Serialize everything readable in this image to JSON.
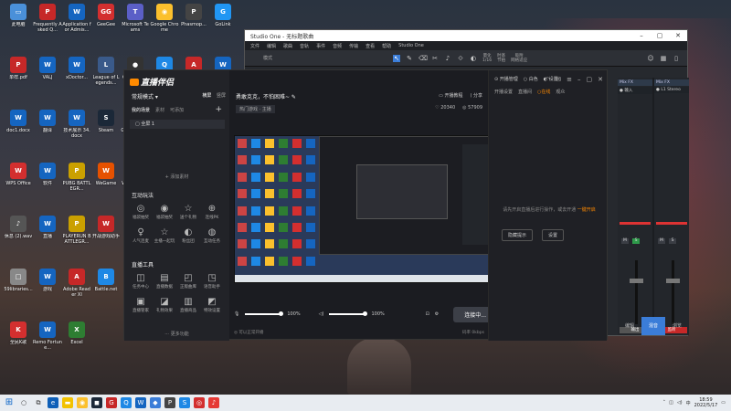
{
  "desktop": {
    "icons": [
      {
        "label": "此电脑",
        "color": "#4a90d9",
        "glyph": "▭"
      },
      {
        "label": "Frequently Asked Q...",
        "color": "#c62828",
        "glyph": "P"
      },
      {
        "label": "Application for Admis...",
        "color": "#1565c0",
        "glyph": "W"
      },
      {
        "label": "GeeGee",
        "color": "#d32f2f",
        "glyph": "GG"
      },
      {
        "label": "Microsoft Teams",
        "color": "#5b5fc7",
        "glyph": "T"
      },
      {
        "label": "Google Chrome",
        "color": "#fbc02d",
        "glyph": "◉"
      },
      {
        "label": "Phasmop...",
        "color": "#444",
        "glyph": "P"
      },
      {
        "label": "GoLink",
        "color": "#2196f3",
        "glyph": "G"
      },
      {
        "label": "单样.pdf",
        "color": "#c62828",
        "glyph": "P"
      },
      {
        "label": "VALJ",
        "color": "#1565c0",
        "glyph": "W"
      },
      {
        "label": "xDoctor...",
        "color": "#1565c0",
        "glyph": "W"
      },
      {
        "label": "League of Legends...",
        "color": "#3a5a8a",
        "glyph": "L"
      },
      {
        "label": "OBS Studio",
        "color": "#333",
        "glyph": "●"
      },
      {
        "label": "腾讯QQ",
        "color": "#1e88e5",
        "glyph": "Q"
      },
      {
        "label": "AMAE",
        "color": "#c62828",
        "glyph": "A"
      },
      {
        "label": "Manuscript...",
        "color": "#1565c0",
        "glyph": "W"
      },
      {
        "label": "doc1.docx",
        "color": "#1565c0",
        "glyph": "W"
      },
      {
        "label": "翻译",
        "color": "#1565c0",
        "glyph": "W"
      },
      {
        "label": "技术展示 34.docx",
        "color": "#1565c0",
        "glyph": "W"
      },
      {
        "label": "Steam",
        "color": "#1b2838",
        "glyph": "S"
      },
      {
        "label": "GeForce Experience",
        "color": "#76b900",
        "glyph": "G"
      },
      {
        "label": "论文",
        "color": "#1565c0",
        "glyph": "W"
      },
      {
        "label": "download",
        "color": "#2196f3",
        "glyph": "e"
      },
      {
        "label": "ToDesk",
        "color": "#1e88e5",
        "glyph": "T"
      },
      {
        "label": "WPS Office",
        "color": "#d32f2f",
        "glyph": "W"
      },
      {
        "label": "软件",
        "color": "#1565c0",
        "glyph": "W"
      },
      {
        "label": "PUBG BATTLEGR...",
        "color": "#caa000",
        "glyph": "P"
      },
      {
        "label": "WeGame",
        "color": "#e65100",
        "glyph": "W"
      },
      {
        "label": "Wallpaper Engine...",
        "color": "#1565c0",
        "glyph": "W"
      },
      {
        "label": "美计...",
        "color": "#1565c0",
        "glyph": "W"
      },
      {
        "label": "使用说明 202...",
        "color": "#1565c0",
        "glyph": "W"
      },
      {
        "label": "风暴英雄",
        "color": "#1565c0",
        "glyph": "W"
      },
      {
        "label": "休息 (2).wav",
        "color": "#555",
        "glyph": "♪"
      },
      {
        "label": "直播",
        "color": "#1565c0",
        "glyph": "W"
      },
      {
        "label": "PLAYERUN BATTLEGR...",
        "color": "#caa000",
        "glyph": "P"
      },
      {
        "label": "开战游戏助手",
        "color": "#c62828",
        "glyph": "W"
      },
      {
        "label": "网易",
        "color": "#1565c0",
        "glyph": "W"
      },
      {
        "label": "登记",
        "color": "#1565c0",
        "glyph": "W"
      },
      {
        "label": "SE对战平台",
        "color": "#1565c0",
        "glyph": "S"
      },
      {
        "label": "网易云",
        "color": "#d32f2f",
        "glyph": "▶"
      },
      {
        "label": "59libraries...",
        "color": "#888",
        "glyph": "□"
      },
      {
        "label": "游戏",
        "color": "#1565c0",
        "glyph": "W"
      },
      {
        "label": "Adobe Reader XI",
        "color": "#c62828",
        "glyph": "A"
      },
      {
        "label": "Battle.net",
        "color": "#1e88e5",
        "glyph": "B"
      },
      {
        "label": "VAL",
        "color": "#1565c0",
        "glyph": "W"
      },
      {
        "label": "直播工具",
        "color": "#1565c0",
        "glyph": "W"
      },
      {
        "label": "AMD虚拟主播 系统",
        "color": "#444",
        "glyph": "A"
      },
      {
        "label": "网易UU加速器",
        "color": "#d32f2f",
        "glyph": "U"
      },
      {
        "label": "全民K歌",
        "color": "#d32f2f",
        "glyph": "K"
      },
      {
        "label": "Remo Fortune...",
        "color": "#1565c0",
        "glyph": "W"
      },
      {
        "label": "Excel",
        "color": "#2e7d32",
        "glyph": "X"
      }
    ]
  },
  "studio_one": {
    "title": "Studio One - 无标题歌曲",
    "menu": [
      "文件",
      "编辑",
      "歌曲",
      "音轨",
      "事件",
      "音频",
      "传输",
      "查看",
      "帮助",
      "Studio One"
    ],
    "toolbar": {
      "mode": "模式",
      "quantize_label": "量化",
      "quantize_value": "1/16",
      "timebase_label": "时基",
      "timebase_value": "节拍",
      "snap_label": "吸附",
      "snap_value": "网格适应"
    },
    "mixer_channels": [
      {
        "name": "Mix FX",
        "input": "● 输入",
        "out": "输出",
        "out_color": "#555",
        "mute": "M",
        "solo": "S"
      },
      {
        "name": "Mix FX",
        "input": "● L1 Stereo",
        "out": "监听",
        "out_color": "#c62828",
        "mute": "M",
        "solo": "S"
      }
    ],
    "bottom_tabs": [
      {
        "label": "编辑",
        "selected": false
      },
      {
        "label": "混音",
        "selected": true
      },
      {
        "label": "浏览",
        "selected": false
      }
    ]
  },
  "live_app": {
    "logo": "直播伴侣",
    "mode": "常规模式 ▾",
    "mode_buttons": [
      "横屏",
      "竖屏"
    ],
    "scene_tabs": [
      "我的场景",
      "素材",
      "可添加"
    ],
    "scene_item": "▢ 全屏 1",
    "add_source": "+ 添加素材",
    "interact_title": "互动玩法",
    "interact_items": [
      {
        "glyph": "◎",
        "label": "福袋抽奖"
      },
      {
        "glyph": "◉",
        "label": "福袋抽奖"
      },
      {
        "glyph": "☆",
        "label": "送个礼物"
      },
      {
        "glyph": "⊕",
        "label": "连线PK"
      },
      {
        "glyph": "♀",
        "label": "人气连麦"
      },
      {
        "glyph": "☆",
        "label": "主播一起玩"
      },
      {
        "glyph": "◐",
        "label": "粉丝团"
      },
      {
        "glyph": "◍",
        "label": "互动任务"
      }
    ],
    "tools_title": "直播工具",
    "tool_items": [
      {
        "glyph": "◫",
        "label": "任务中心"
      },
      {
        "glyph": "▤",
        "label": "直播数据"
      },
      {
        "glyph": "◰",
        "label": "正版曲库"
      },
      {
        "glyph": "◳",
        "label": "语音助手"
      },
      {
        "glyph": "▣",
        "label": "直播管家"
      },
      {
        "glyph": "◪",
        "label": "礼物效果"
      },
      {
        "glyph": "▥",
        "label": "直播商品"
      },
      {
        "glyph": "◩",
        "label": "特效设置"
      }
    ],
    "more": "⋯ 更多功能",
    "room_title": "勇敢克克，不怕困难~ ✎",
    "room_tag": "热门游戏 · 主播",
    "room_right": [
      "▭ 开播教程",
      "⟨ 分享"
    ],
    "room_stats": [
      "♡ 20340",
      "◎ 57909"
    ],
    "volume_mic": "100%",
    "volume_sys": "100%",
    "live_button": "连接中...",
    "status_left": "◎ 可以正常开播",
    "status_right": [
      "码率 0kbps",
      "FPS 60",
      "丢帧 0.00%",
      "CPU 11%",
      "内存 36%",
      "18:55"
    ],
    "side": {
      "top": [
        "⊙ 开播管理",
        "○ 白色",
        "◐ 设置"
      ],
      "tabs": [
        "开播设置",
        "直播间",
        "○在线",
        "观众"
      ],
      "message": "请先开启直播后进行操作，或去开通",
      "link": "一键开启",
      "buttons": [
        "隐藏提示",
        "设置"
      ]
    }
  },
  "taskbar": {
    "apps": [
      {
        "glyph": "⊞",
        "color": "transparent",
        "cls": "win"
      },
      {
        "glyph": "○",
        "color": "transparent",
        "cls": "plain"
      },
      {
        "glyph": "⧉",
        "color": "transparent",
        "cls": "plain"
      },
      {
        "glyph": "e",
        "color": "#0e5fb8",
        "cls": ""
      },
      {
        "glyph": "▬",
        "color": "#f2c200",
        "cls": ""
      },
      {
        "glyph": "◉",
        "color": "#fbc02d",
        "cls": ""
      },
      {
        "glyph": "◼",
        "color": "#1b2838",
        "cls": ""
      },
      {
        "glyph": "G",
        "color": "#c62828",
        "cls": ""
      },
      {
        "glyph": "Q",
        "color": "#1e88e5",
        "cls": ""
      },
      {
        "glyph": "W",
        "color": "#1565c0",
        "cls": ""
      },
      {
        "glyph": "◆",
        "color": "#3b7dd8",
        "cls": ""
      },
      {
        "glyph": "P",
        "color": "#444",
        "cls": ""
      },
      {
        "glyph": "S",
        "color": "#1e88e5",
        "cls": ""
      },
      {
        "glyph": "◎",
        "color": "#d32f2f",
        "cls": ""
      },
      {
        "glyph": "♪",
        "color": "#e53935",
        "cls": ""
      }
    ],
    "time": "18:59",
    "date": "2022/5/17"
  }
}
